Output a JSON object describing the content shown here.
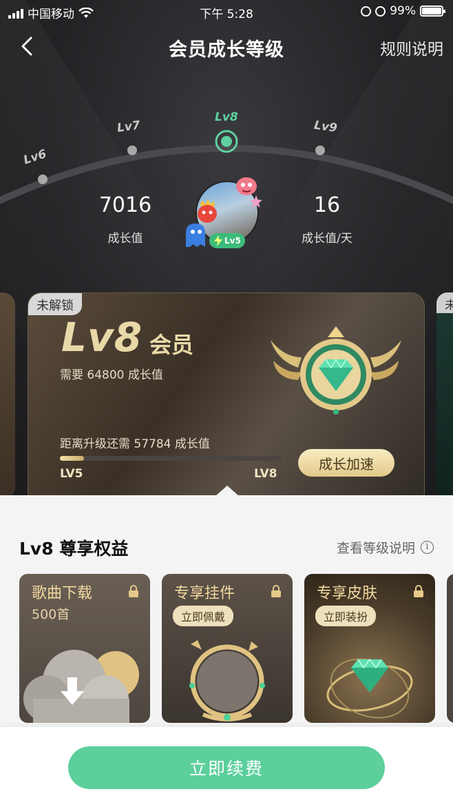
{
  "status_bar": {
    "carrier": "中国移动",
    "time": "下午 5:28",
    "battery": "99%"
  },
  "nav": {
    "title": "会员成长等级",
    "rules": "规则说明"
  },
  "levels": [
    {
      "label": "Lv6"
    },
    {
      "label": "Lv7"
    },
    {
      "label": "Lv8",
      "current": true
    },
    {
      "label": "Lv9"
    }
  ],
  "stats": {
    "growth_value": "7016",
    "growth_label": "成长值",
    "daily_value": "16",
    "daily_label": "成长值/天"
  },
  "avatar": {
    "badge": "Lv5"
  },
  "card": {
    "lock_tag": "未解锁",
    "level": "Lv8",
    "member": "会员",
    "need": "需要 64800 成长值",
    "distance": "距离升级还需 57784 成长值",
    "progress": 0.11,
    "from_level": "LV5",
    "to_level": "LV8",
    "speed_button": "成长加速"
  },
  "side_card_right_tag": "未",
  "benefits": {
    "title": "Lv8 尊享权益",
    "link": "查看等级说明",
    "items": [
      {
        "title": "歌曲下载",
        "sub": "500首"
      },
      {
        "title": "专享挂件",
        "action": "立即佩戴"
      },
      {
        "title": "专享皮肤",
        "action": "立即装扮"
      }
    ]
  },
  "footer": {
    "renew_button": "立即续费"
  },
  "colors": {
    "accent": "#5ccf9b",
    "gold": "#e9d9a8",
    "bg_dark": "#232326"
  }
}
